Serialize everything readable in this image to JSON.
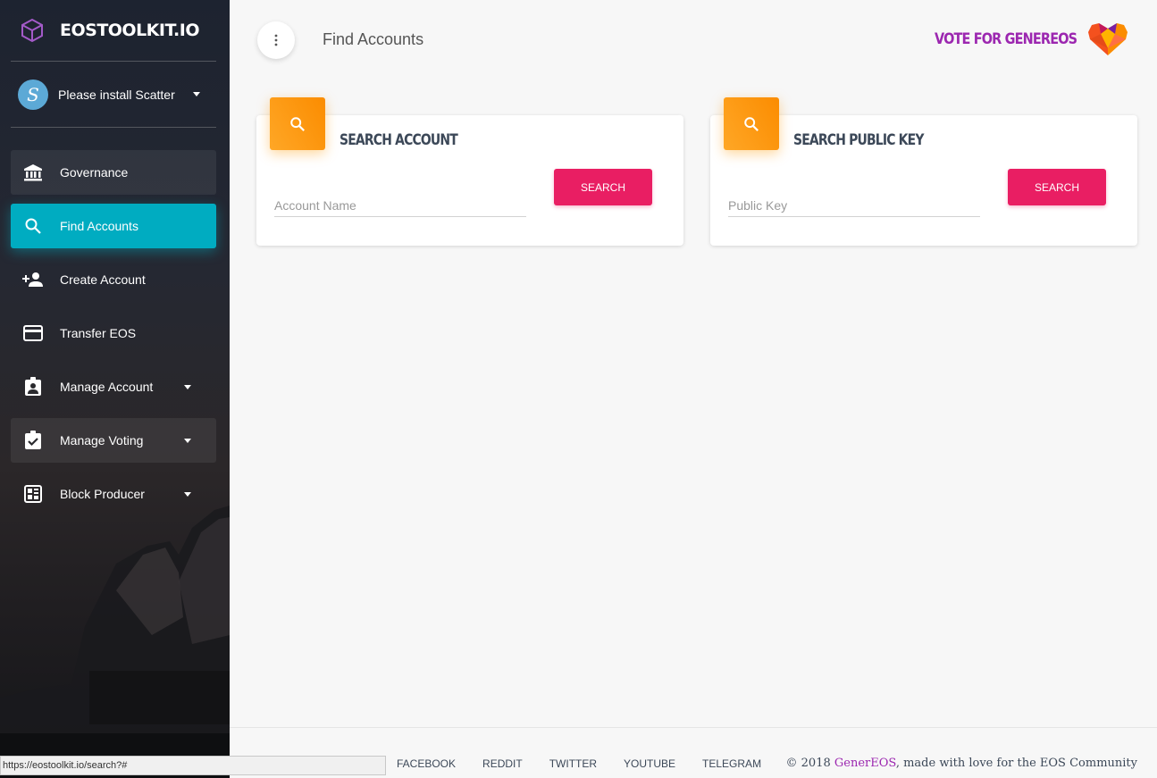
{
  "brand": {
    "title": "EOSTOOLKIT.IO"
  },
  "user": {
    "label": "Please install Scatter"
  },
  "nav": {
    "items": [
      {
        "label": "Governance"
      },
      {
        "label": "Find Accounts"
      },
      {
        "label": "Create Account"
      },
      {
        "label": "Transfer EOS"
      },
      {
        "label": "Manage Account"
      },
      {
        "label": "Manage Voting"
      },
      {
        "label": "Block Producer"
      }
    ]
  },
  "header": {
    "title": "Find Accounts",
    "vote_label": "VOTE FOR GENEREOS"
  },
  "cards": {
    "account": {
      "title": "SEARCH ACCOUNT",
      "placeholder": "Account Name",
      "button": "SEARCH"
    },
    "pubkey": {
      "title": "SEARCH PUBLIC KEY",
      "placeholder": "Public Key",
      "button": "SEARCH"
    }
  },
  "footer": {
    "links": [
      "FACEBOOK",
      "REDDIT",
      "TWITTER",
      "YOUTUBE",
      "TELEGRAM"
    ],
    "copyright_prefix": "© 2018 ",
    "copyright_brand": "GenerEOS",
    "copyright_suffix": ", made with love for the EOS Community"
  },
  "status_url": "https://eostoolkit.io/search?#",
  "colors": {
    "active": "#00acc1",
    "accent": "#9c27b0",
    "button": "#e91e63",
    "icon_bg": "#ff9800"
  }
}
